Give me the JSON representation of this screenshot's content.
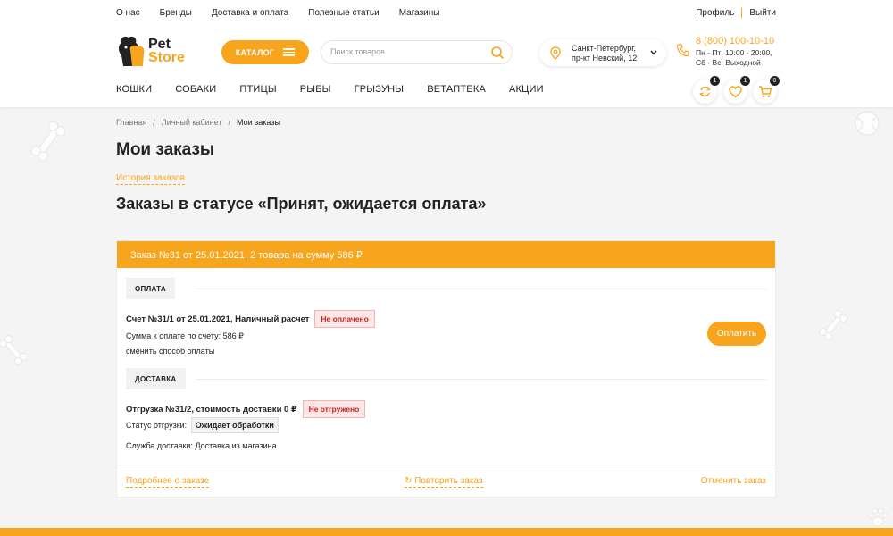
{
  "topnav": [
    "О нас",
    "Бренды",
    "Доставка и оплата",
    "Полезные статьи",
    "Магазины"
  ],
  "toplinks": {
    "profile": "Профиль",
    "logout": "Выйти"
  },
  "logo": {
    "line1": "Pet",
    "line2": "Store"
  },
  "catalog_label": "КАТАЛОГ",
  "search": {
    "placeholder": "Поиск товаров",
    "value": ""
  },
  "location": {
    "line1": "Санкт-Петербург,",
    "line2": "пр-кт Невский, 12"
  },
  "contacts": {
    "phone": "8 (800) 100-10-10",
    "hours1": "Пн - Пт: 10:00 - 20:00,",
    "hours2": "Сб - Вс: Выходной"
  },
  "mainnav": [
    "КОШКИ",
    "СОБАКИ",
    "ПТИЦЫ",
    "РЫБЫ",
    "ГРЫЗУНЫ",
    "ВЕТАПТЕКА",
    "АКЦИИ"
  ],
  "counters": {
    "compare": "1",
    "favorites": "1",
    "cart": "0"
  },
  "breadcrumb": [
    "Главная",
    "Личный кабинет",
    "Мои заказы"
  ],
  "page_title": "Мои заказы",
  "history_link": "История заказов",
  "status_title": "Заказы в статусе «Принят, ожидается оплата»",
  "order": {
    "header": "Заказ №31 от 25.01.2021, 2 товара на сумму 586 ₽",
    "payment_section": "ОПЛАТА",
    "invoice_title": "Счет №31/1 от 25.01.2021, Наличный расчет",
    "invoice_badge": "Не оплачено",
    "amount_line": "Сумма к оплате по счету: 586 ₽",
    "change_method": "сменить способ оплаты",
    "pay_button": "Оплатить",
    "delivery_section": "ДОСТАВКА",
    "shipment_title": "Отгрузка №31/2, стоимость доставки 0 ₽",
    "shipment_badge": "Не отгружено",
    "shipment_status_label": "Статус отгрузки:",
    "shipment_status_value": "Ожидает обработки",
    "delivery_service": "Служба доставки: Доставка из магазина",
    "details_link": "Подробнее о заказе",
    "repeat_link": "Повторить заказ",
    "cancel_link": "Отменить заказ"
  },
  "colors": {
    "accent": "#f8a51e",
    "danger": "#cc2222"
  }
}
